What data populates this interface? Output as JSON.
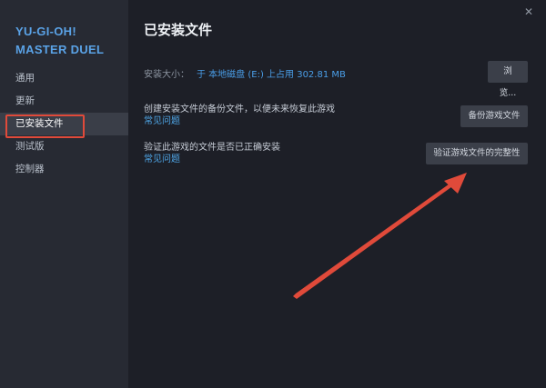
{
  "sidebar": {
    "game_title_line1": "YU-GI-OH!",
    "game_title_line2": "MASTER DUEL",
    "items": [
      {
        "label": "通用"
      },
      {
        "label": "更新"
      },
      {
        "label": "已安装文件"
      },
      {
        "label": "测试版"
      },
      {
        "label": "控制器"
      }
    ],
    "active_index": 2
  },
  "header": {
    "title": "已安装文件",
    "close_symbol": "✕"
  },
  "install_size": {
    "label": "安装大小：",
    "value": "于 本地磁盘 (E:) 上占用 302.81 MB",
    "browse_label": "浏览..."
  },
  "backup": {
    "description": "创建安装文件的备份文件，以便未来恢复此游戏",
    "link": "常见问题",
    "button_label": "备份游戏文件"
  },
  "verify": {
    "description": "验证此游戏的文件是否已正确安装",
    "link": "常见问题",
    "button_label": "验证游戏文件的完整性"
  },
  "colors": {
    "accent_blue": "#5aa2e6",
    "link_blue": "#4fa7e8",
    "highlight_red": "#e04a3a",
    "sidebar_bg": "#272a33",
    "main_bg": "#1d1f27"
  }
}
